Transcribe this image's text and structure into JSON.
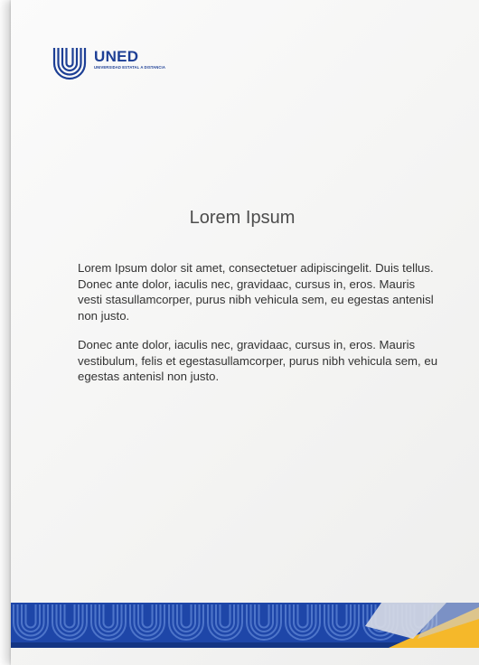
{
  "logo": {
    "name": "UNED",
    "subtitle": "UNIVERSIDAD ESTATAL A DISTANCIA"
  },
  "document": {
    "title": "Lorem Ipsum",
    "paragraphs": [
      "Lorem Ipsum dolor sit amet, consectetuer adipiscingelit. Duis tellus. Donec ante dolor, iaculis nec, gravidaac, cursus in, eros. Mauris vesti stasullamcorper, purus nibh vehicula sem, eu egestas antenisl non justo.",
      "Donec ante dolor, iaculis nec, gravidaac, cursus in, eros. Mauris vestibulum, felis et egestasullamcorper, purus nibh vehicula sem, eu egestas antenisl non justo."
    ]
  },
  "colors": {
    "brand_blue": "#1d3f95",
    "footer_blue": "#1e46a8",
    "accent_yellow": "#f5b82a",
    "text": "#333333"
  }
}
